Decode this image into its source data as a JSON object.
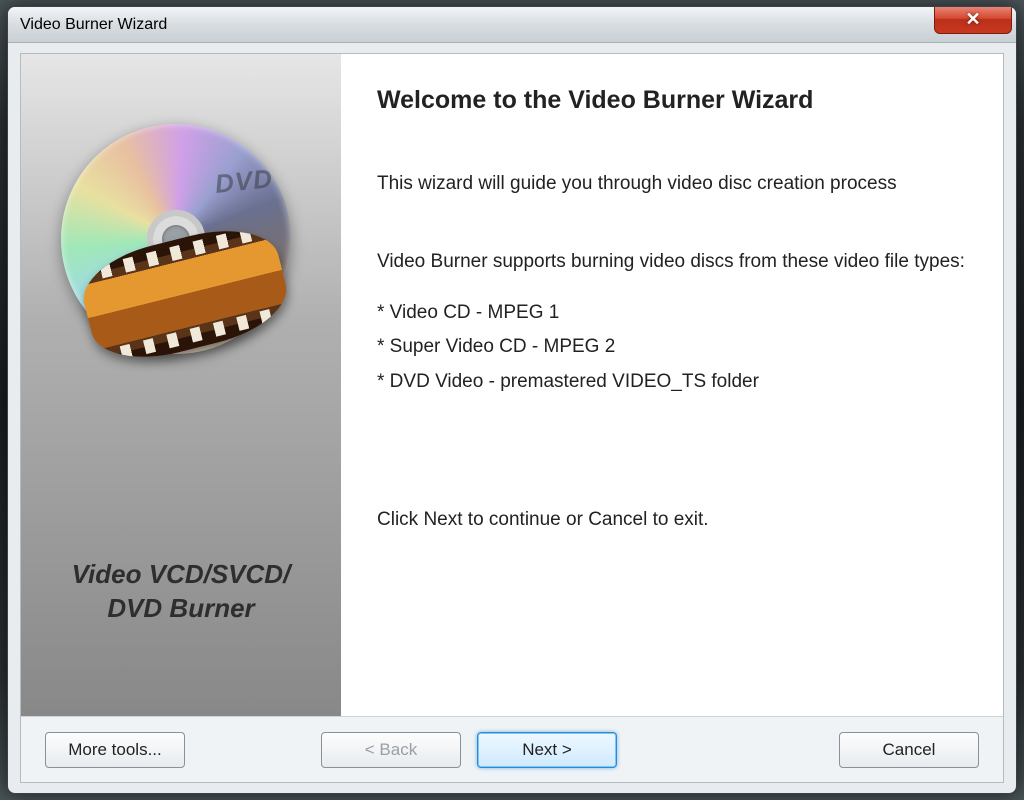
{
  "window": {
    "title": "Video Burner Wizard",
    "close_glyph": "✕"
  },
  "side": {
    "dvd_text": "DVD",
    "caption_line1": "Video VCD/SVCD/",
    "caption_line2": "DVD Burner"
  },
  "main": {
    "heading": "Welcome to the Video Burner Wizard",
    "intro": "This wizard will guide you through video disc creation process",
    "supports_intro": "Video Burner supports burning video discs from these video file types:",
    "bullets": [
      "* Video CD - MPEG 1",
      "* Super Video CD - MPEG 2",
      "* DVD Video - premastered VIDEO_TS folder"
    ],
    "continue_hint": "Click Next to continue or Cancel to exit."
  },
  "footer": {
    "more_tools": "More tools...",
    "back": "< Back",
    "next": "Next >",
    "cancel": "Cancel"
  }
}
